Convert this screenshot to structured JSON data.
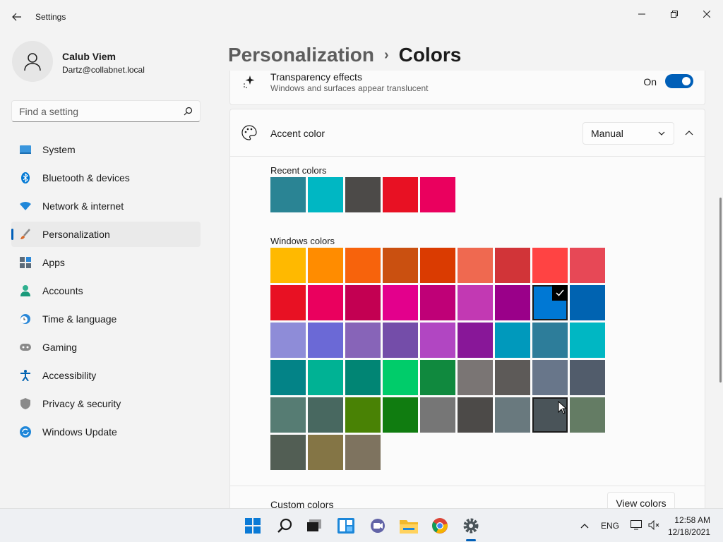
{
  "window": {
    "title": "Settings"
  },
  "user": {
    "name": "Calub Viem",
    "email": "Dartz@collabnet.local"
  },
  "search": {
    "placeholder": "Find a setting"
  },
  "sidebar": {
    "items": [
      {
        "label": "System",
        "icon": "monitor-icon"
      },
      {
        "label": "Bluetooth & devices",
        "icon": "bluetooth-icon"
      },
      {
        "label": "Network & internet",
        "icon": "wifi-icon"
      },
      {
        "label": "Personalization",
        "icon": "brush-icon",
        "active": true
      },
      {
        "label": "Apps",
        "icon": "apps-icon"
      },
      {
        "label": "Accounts",
        "icon": "person-icon"
      },
      {
        "label": "Time & language",
        "icon": "clock-globe-icon"
      },
      {
        "label": "Gaming",
        "icon": "gamepad-icon"
      },
      {
        "label": "Accessibility",
        "icon": "accessibility-icon"
      },
      {
        "label": "Privacy & security",
        "icon": "shield-icon"
      },
      {
        "label": "Windows Update",
        "icon": "update-icon"
      }
    ]
  },
  "breadcrumb": {
    "parent": "Personalization",
    "separator": "›",
    "current": "Colors"
  },
  "transparency": {
    "title": "Transparency effects",
    "description": "Windows and surfaces appear translucent",
    "state": "On"
  },
  "accent": {
    "title": "Accent color",
    "mode": "Manual",
    "recent_label": "Recent colors",
    "recent_colors": [
      "#2a8494",
      "#00b7c3",
      "#4c4a48",
      "#e81123",
      "#ea005e"
    ],
    "windows_label": "Windows colors",
    "windows_colors": [
      [
        "#ffb900",
        "#ff8c00",
        "#f7630c",
        "#ca5010",
        "#da3b01",
        "#ef6950",
        "#d13438",
        "#ff4343",
        "#e74856"
      ],
      [
        "#e81123",
        "#ea005e",
        "#c30052",
        "#e3008c",
        "#bf0077",
        "#c239b3",
        "#9a0089",
        "#0078d4",
        "#0063b1"
      ],
      [
        "#8e8cd8",
        "#6b69d6",
        "#8764b8",
        "#744da9",
        "#b146c2",
        "#881798",
        "#0099bc",
        "#2d7d9a",
        "#00b7c3"
      ],
      [
        "#038387",
        "#00b294",
        "#018574",
        "#00cc6a",
        "#10893e",
        "#7a7574",
        "#5d5a58",
        "#68768a",
        "#515c6b"
      ],
      [
        "#567c73",
        "#486860",
        "#498205",
        "#107c10",
        "#767676",
        "#4c4a48",
        "#69797e",
        "#4a5459",
        "#647c64"
      ],
      [
        "#525e54",
        "#847545",
        "#7e735f"
      ]
    ],
    "selected_color": "#0078d4",
    "custom_label": "Custom colors",
    "view_colors_label": "View colors"
  },
  "taskbar": {
    "apps": [
      "windows-start-icon",
      "search-icon",
      "task-view-icon",
      "widgets-icon",
      "teams-chat-icon",
      "file-explorer-icon",
      "chrome-icon",
      "settings-icon"
    ],
    "language": "ENG",
    "time": "12:58 AM",
    "date": "12/18/2021"
  }
}
